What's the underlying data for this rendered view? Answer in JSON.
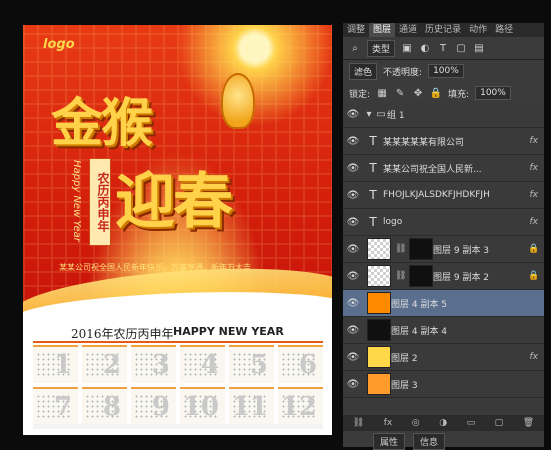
{
  "poster": {
    "logo": "logo",
    "headline_line1": "金猴",
    "headline_line2": "迎春",
    "lunar_label": "农历丙申年",
    "hny_vertical": "Happy New Year",
    "greeting": "某某公司祝全国人民新年快乐，万事亨通，新年万大吉",
    "calendar_title": "2016年农历丙申年",
    "calendar_en": "HAPPY NEW YEAR",
    "months": [
      "1",
      "2",
      "3",
      "4",
      "5",
      "6",
      "7",
      "8",
      "9",
      "10",
      "11",
      "12"
    ]
  },
  "panel": {
    "tabs": [
      "调整",
      "图层",
      "通道",
      "历史记录",
      "动作",
      "路径"
    ],
    "active_tab": "图层",
    "filter_label": "类型",
    "blend_mode": "滤色",
    "opacity_label": "不透明度:",
    "opacity_value": "100%",
    "lock_label": "锁定:",
    "fill_label": "填充:",
    "fill_value": "100%",
    "group_name": "组 1",
    "layers": [
      {
        "name": "某某某某某有限公司",
        "type": "text",
        "fx": true
      },
      {
        "name": "某某公司祝全国人民新...",
        "type": "text",
        "fx": true
      },
      {
        "name": "FHOJLKJALSDKFJHDKFJH",
        "type": "text",
        "fx": true
      },
      {
        "name": "logo",
        "type": "text",
        "fx": true
      },
      {
        "name": "图层 9 副本 3",
        "type": "mask",
        "fx": false
      },
      {
        "name": "图层 9 副本 2",
        "type": "mask",
        "fx": false
      },
      {
        "name": "图层 4 副本 5",
        "type": "image",
        "selected": true
      },
      {
        "name": "图层 4 副本 4",
        "type": "image"
      },
      {
        "name": "图层 2",
        "type": "image",
        "fx": true
      },
      {
        "name": "图层 3",
        "type": "image"
      }
    ],
    "bottom_tabs": [
      "属性",
      "信息"
    ]
  }
}
